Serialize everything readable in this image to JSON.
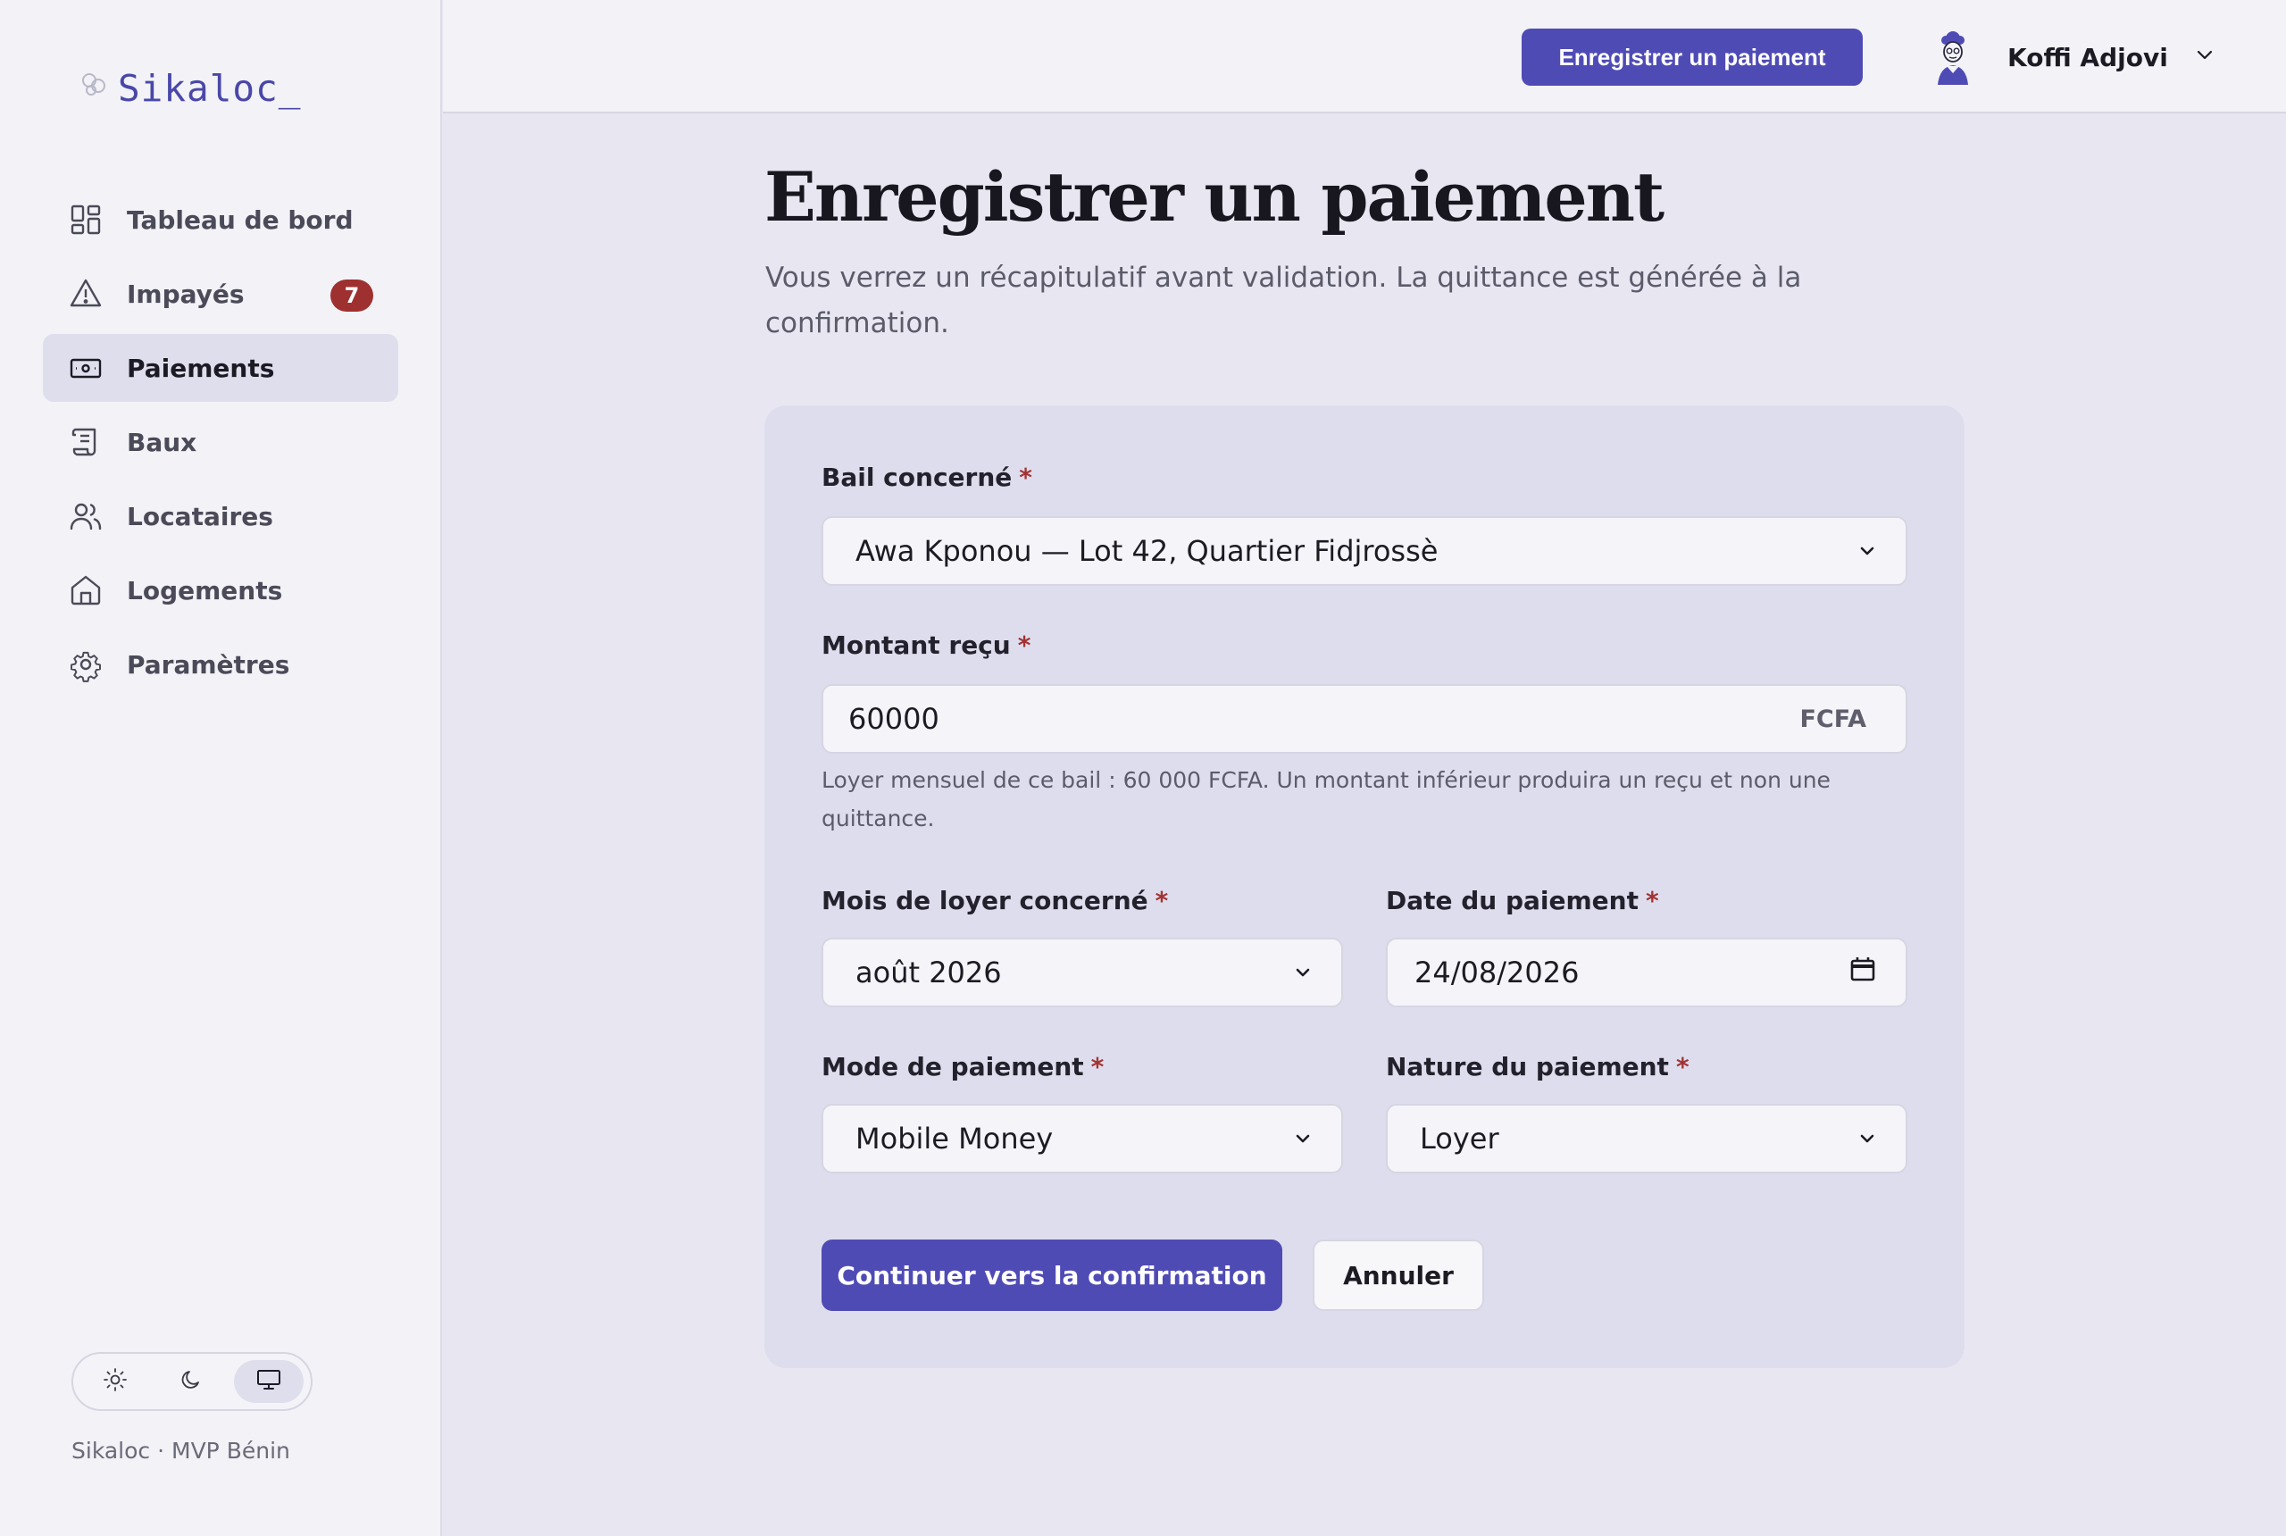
{
  "app": {
    "logo_text": "Sikaloc_",
    "footer_note": "Sikaloc · MVP Bénin"
  },
  "sidebar": {
    "items": [
      {
        "label": "Tableau de bord",
        "icon": "dashboard-icon"
      },
      {
        "label": "Impayés",
        "icon": "warning-icon",
        "badge": "7"
      },
      {
        "label": "Paiements",
        "icon": "banknote-icon",
        "active": true
      },
      {
        "label": "Baux",
        "icon": "scroll-icon"
      },
      {
        "label": "Locataires",
        "icon": "users-icon"
      },
      {
        "label": "Logements",
        "icon": "house-icon"
      },
      {
        "label": "Paramètres",
        "icon": "gear-icon"
      }
    ],
    "theme_options": [
      "sun-icon",
      "moon-icon",
      "monitor-icon"
    ],
    "theme_selected": "monitor-icon"
  },
  "header": {
    "cta_label": "Enregistrer un paiement",
    "user_name": "Koffi Adjovi"
  },
  "main": {
    "title": "Enregistrer un paiement",
    "subtitle": "Vous verrez un récapitulatif avant validation. La quittance est générée à la confirmation."
  },
  "form": {
    "required_mark": "*",
    "bail": {
      "label": "Bail concerné",
      "value": "Awa Kponou — Lot 42, Quartier Fidjrossè"
    },
    "montant": {
      "label": "Montant reçu",
      "value": "60000",
      "suffix": "FCFA",
      "help": "Loyer mensuel de ce bail : 60 000 FCFA. Un montant inférieur produira un reçu et non une quittance."
    },
    "mois": {
      "label": "Mois de loyer concerné",
      "value": "août 2026"
    },
    "date": {
      "label": "Date du paiement",
      "value": "24/08/2026"
    },
    "mode": {
      "label": "Mode de paiement",
      "value": "Mobile Money"
    },
    "nature": {
      "label": "Nature du paiement",
      "value": "Loyer"
    },
    "submit_label": "Continuer vers la confirmation",
    "cancel_label": "Annuler"
  },
  "colors": {
    "accent": "#4f4bb5",
    "badge": "#9e3030",
    "required": "#a33333"
  }
}
